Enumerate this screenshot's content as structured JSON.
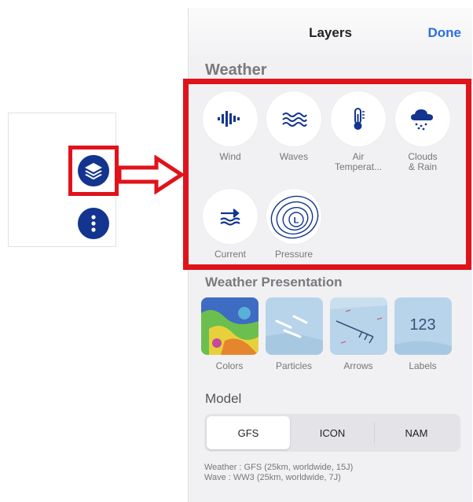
{
  "sheet": {
    "title": "Layers",
    "done_label": "Done"
  },
  "weather": {
    "section_title": "Weather",
    "items": [
      {
        "label": "Wind",
        "icon": "wind-icon"
      },
      {
        "label": "Waves",
        "icon": "waves-icon"
      },
      {
        "label": "Air Temperat...",
        "icon": "thermometer-icon"
      },
      {
        "label": "Clouds & Rain",
        "icon": "cloud-rain-icon"
      },
      {
        "label": "Current",
        "icon": "current-icon"
      },
      {
        "label": "Pressure",
        "icon": "pressure-icon"
      }
    ]
  },
  "presentation": {
    "section_title": "Weather Presentation",
    "items": [
      {
        "label": "Colors"
      },
      {
        "label": "Particles"
      },
      {
        "label": "Arrows"
      },
      {
        "label": "Labels"
      }
    ],
    "labels_thumb_text": "123"
  },
  "model": {
    "section_title": "Model",
    "options": [
      "GFS",
      "ICON",
      "NAM"
    ],
    "selected": "GFS",
    "info_weather": "Weather : GFS (25km, worldwide, 15J)",
    "info_wave": "Wave : WW3 (25km, worldwide, 7J)"
  },
  "colors": {
    "accent": "#2a6fe0",
    "highlight": "#e0131b",
    "icon_blue": "#13348f"
  }
}
